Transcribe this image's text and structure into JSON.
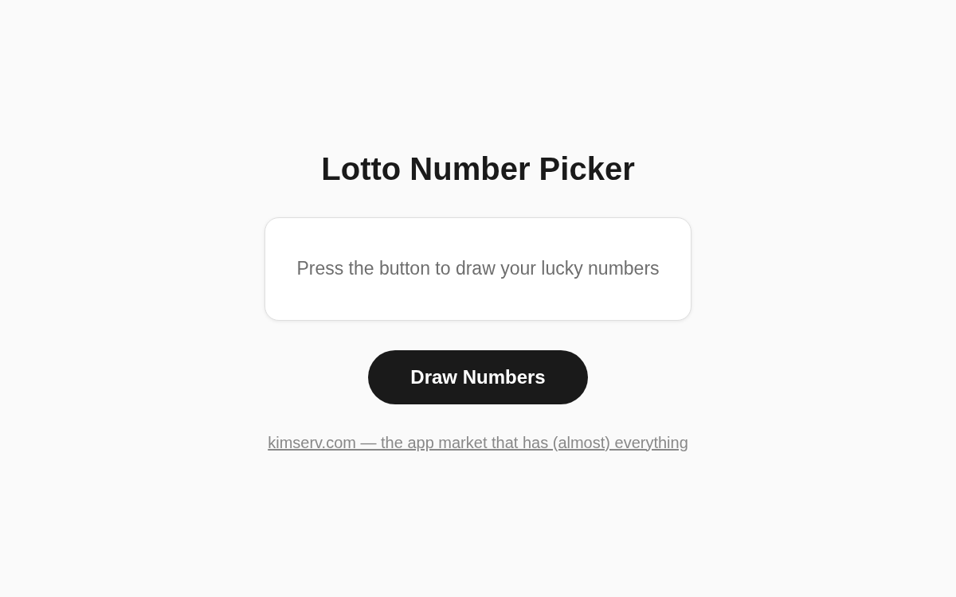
{
  "title": "Lotto Number Picker",
  "result_panel": {
    "message": "Press the button to draw your lucky numbers"
  },
  "draw_button": {
    "label": "Draw Numbers"
  },
  "footer_link": {
    "text": "kimserv.com — the app market that has (almost) everything"
  }
}
